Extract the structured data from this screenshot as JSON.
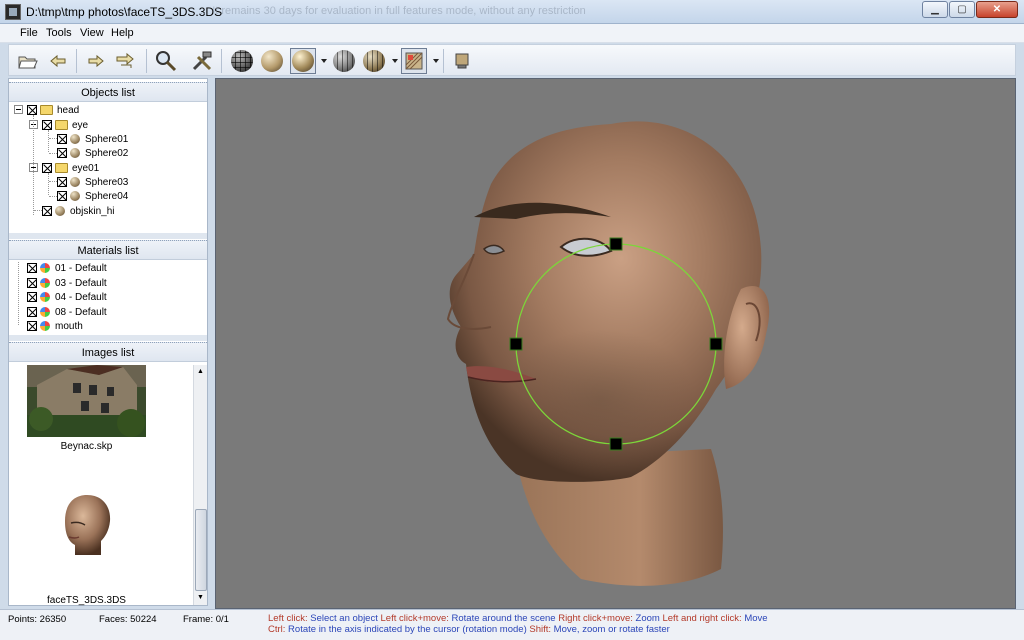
{
  "window": {
    "title": "D:\\tmp\\tmp photos\\faceTS_3DS.3DS",
    "ghost_text": "... It remains 30 days for evaluation in full features mode, without any restriction"
  },
  "menu": [
    "File",
    "Tools",
    "View",
    "Help"
  ],
  "objects_list": {
    "title": "Objects list",
    "items": [
      "head",
      "eye",
      "Sphere01",
      "Sphere02",
      "eye01",
      "Sphere03",
      "Sphere04",
      "objskin_hi"
    ]
  },
  "materials_list": {
    "title": "Materials list",
    "items": [
      "01 - Default",
      "03 - Default",
      "04 - Default",
      "08 - Default",
      "mouth"
    ]
  },
  "images_list": {
    "title": "Images list",
    "items": [
      "Beynac.skp",
      "faceTS_3DS.3DS"
    ]
  },
  "status": {
    "points": "Points: 26350",
    "faces": "Faces: 50224",
    "frame": "Frame: 0/1",
    "help1": [
      {
        "t": "Left click:",
        "c": "red"
      },
      {
        "t": " Select an object ",
        "c": "blue"
      },
      {
        "t": "Left click+move:",
        "c": "red"
      },
      {
        "t": " Rotate around the scene ",
        "c": "blue"
      },
      {
        "t": "Right click+move:",
        "c": "red"
      },
      {
        "t": " Zoom ",
        "c": "blue"
      },
      {
        "t": "Left and right click:",
        "c": "red"
      },
      {
        "t": " Move",
        "c": "blue"
      }
    ],
    "help2": [
      {
        "t": "Ctrl:",
        "c": "red"
      },
      {
        "t": " Rotate in the axis indicated by the cursor (rotation mode) ",
        "c": "blue"
      },
      {
        "t": "Shift:",
        "c": "red"
      },
      {
        "t": " Move, zoom or rotate faster",
        "c": "blue"
      }
    ]
  },
  "colors": {
    "viewport_bg": "#7a7a7a",
    "gizmo": "#7cd63a",
    "help_key": "#b33a2a",
    "help_action": "#2c46b8"
  },
  "icons": [
    "open-icon",
    "undo-icon",
    "redo-icon",
    "rotate-icon",
    "zoom-icon",
    "tools-icon",
    "wireframe-sphere-icon",
    "smooth-sphere-icon",
    "shaded-sphere-icon",
    "halfwire-sphere-icon",
    "textured-sphere-icon",
    "texture-mode-icon",
    "export-icon"
  ]
}
